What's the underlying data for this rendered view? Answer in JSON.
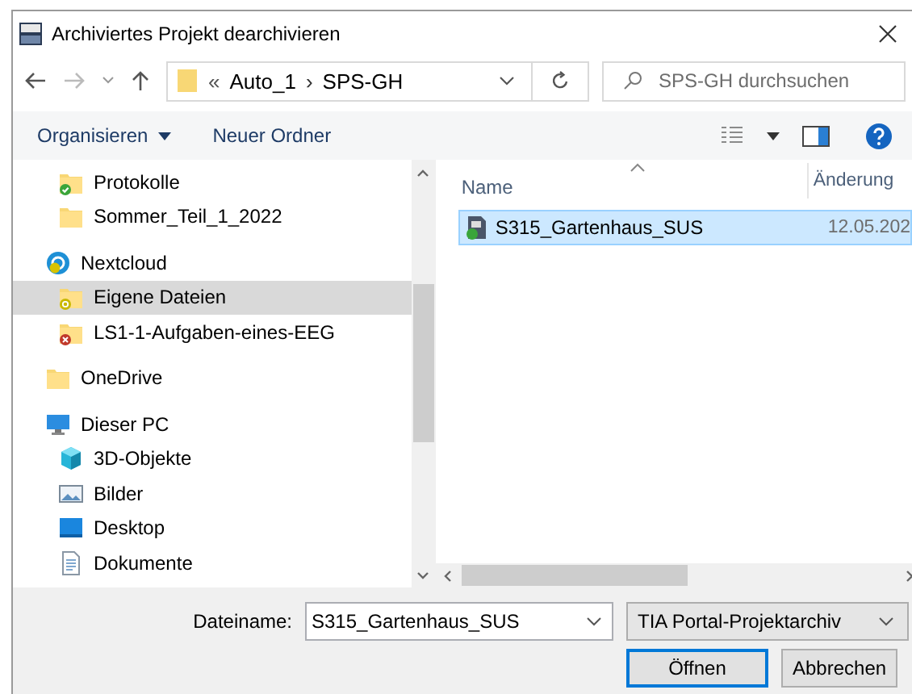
{
  "window": {
    "title": "Archiviertes Projekt dearchivieren"
  },
  "address": {
    "overflow": "«",
    "path": [
      "Auto_1",
      "SPS-GH"
    ],
    "separator": "›"
  },
  "search": {
    "placeholder": "SPS-GH durchsuchen"
  },
  "toolbar": {
    "organize": "Organisieren",
    "new_folder": "Neuer Ordner"
  },
  "nav": {
    "items": [
      {
        "children": [
          {
            "label": "Protokolle",
            "kind": "synced",
            "selected": false
          },
          {
            "label": "Sommer_Teil_1_2022",
            "kind": "folder",
            "selected": false
          }
        ]
      },
      {
        "label": "Nextcloud",
        "kind": "cloud",
        "selected": false,
        "children": [
          {
            "label": "Eigene Dateien",
            "kind": "syncing",
            "selected": true
          },
          {
            "label": "LS1-1-Aufgaben-eines-EEG",
            "kind": "error",
            "selected": false
          }
        ]
      },
      {
        "label": "OneDrive",
        "kind": "folder",
        "selected": false
      },
      {
        "label": "Dieser PC",
        "kind": "pc",
        "selected": false,
        "children": [
          {
            "label": "3D-Objekte",
            "kind": "cube",
            "selected": false
          },
          {
            "label": "Bilder",
            "kind": "picture",
            "selected": false
          },
          {
            "label": "Desktop",
            "kind": "desktop",
            "selected": false
          },
          {
            "label": "Dokumente",
            "kind": "document",
            "selected": false
          }
        ]
      }
    ]
  },
  "file_list": {
    "columns": [
      {
        "label": "Name",
        "sorted": true
      },
      {
        "label": "Änderung",
        "sorted": false
      }
    ],
    "rows": [
      {
        "name": "S315_Gartenhaus_SUS",
        "date": "12.05.202",
        "selected": true
      }
    ]
  },
  "footer": {
    "filename_label": "Dateiname:",
    "filename": "S315_Gartenhaus_SUS",
    "filter": "TIA Portal-Projektarchiv",
    "buttons": [
      {
        "label": "Öffnen",
        "default": true
      },
      {
        "label": "Abbrechen",
        "default": false
      }
    ]
  }
}
